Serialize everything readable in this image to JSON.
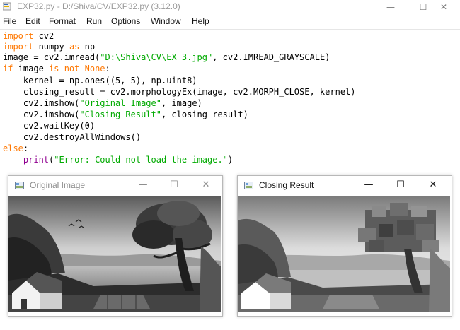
{
  "window": {
    "title": "EXP32.py - D:/Shiva/CV/EXP32.py (3.12.0)",
    "minimize": "—",
    "maximize": "☐",
    "close": "✕"
  },
  "menu": [
    "File",
    "Edit",
    "Format",
    "Run",
    "Options",
    "Window",
    "Help"
  ],
  "code": {
    "l1_kw": "import",
    "l1_rest": " cv2",
    "l2_kw": "import",
    "l2_mid": " numpy ",
    "l2_kw2": "as",
    "l2_rest": " np",
    "l3_pre": "image = cv2.imread(",
    "l3_str": "\"D:\\Shiva\\CV\\EX 3.jpg\"",
    "l3_post": ", cv2.IMREAD_GRAYSCALE)",
    "l4_kw": "if",
    "l4_mid": " image ",
    "l4_kw2": "is not",
    "l4_sp": " ",
    "l4_kw3": "None",
    "l4_end": ":",
    "l5": "    kernel = np.ones((5, 5), np.uint8)",
    "l6": "    closing_result = cv2.morphologyEx(image, cv2.MORPH_CLOSE, kernel)",
    "l7_pre": "    cv2.imshow(",
    "l7_str": "\"Original Image\"",
    "l7_post": ", image)",
    "l8_pre": "    cv2.imshow(",
    "l8_str": "\"Closing Result\"",
    "l8_post": ", closing_result)",
    "l9": "    cv2.waitKey(0)",
    "l10": "    cv2.destroyAllWindows()",
    "l11_kw": "else",
    "l11_end": ":",
    "l12_pre": "    ",
    "l12_bi": "print",
    "l12_open": "(",
    "l12_str": "\"Error: Could not load the image.\"",
    "l12_close": ")"
  },
  "colors": {
    "keyword": "#ff7700",
    "string": "#00aa00",
    "builtin": "#900090"
  },
  "cv_windows": {
    "original": {
      "title": "Original Image",
      "minimize": "—",
      "maximize": "☐",
      "close": "✕"
    },
    "closing": {
      "title": "Closing Result",
      "minimize": "—",
      "maximize": "☐",
      "close": "✕"
    }
  }
}
